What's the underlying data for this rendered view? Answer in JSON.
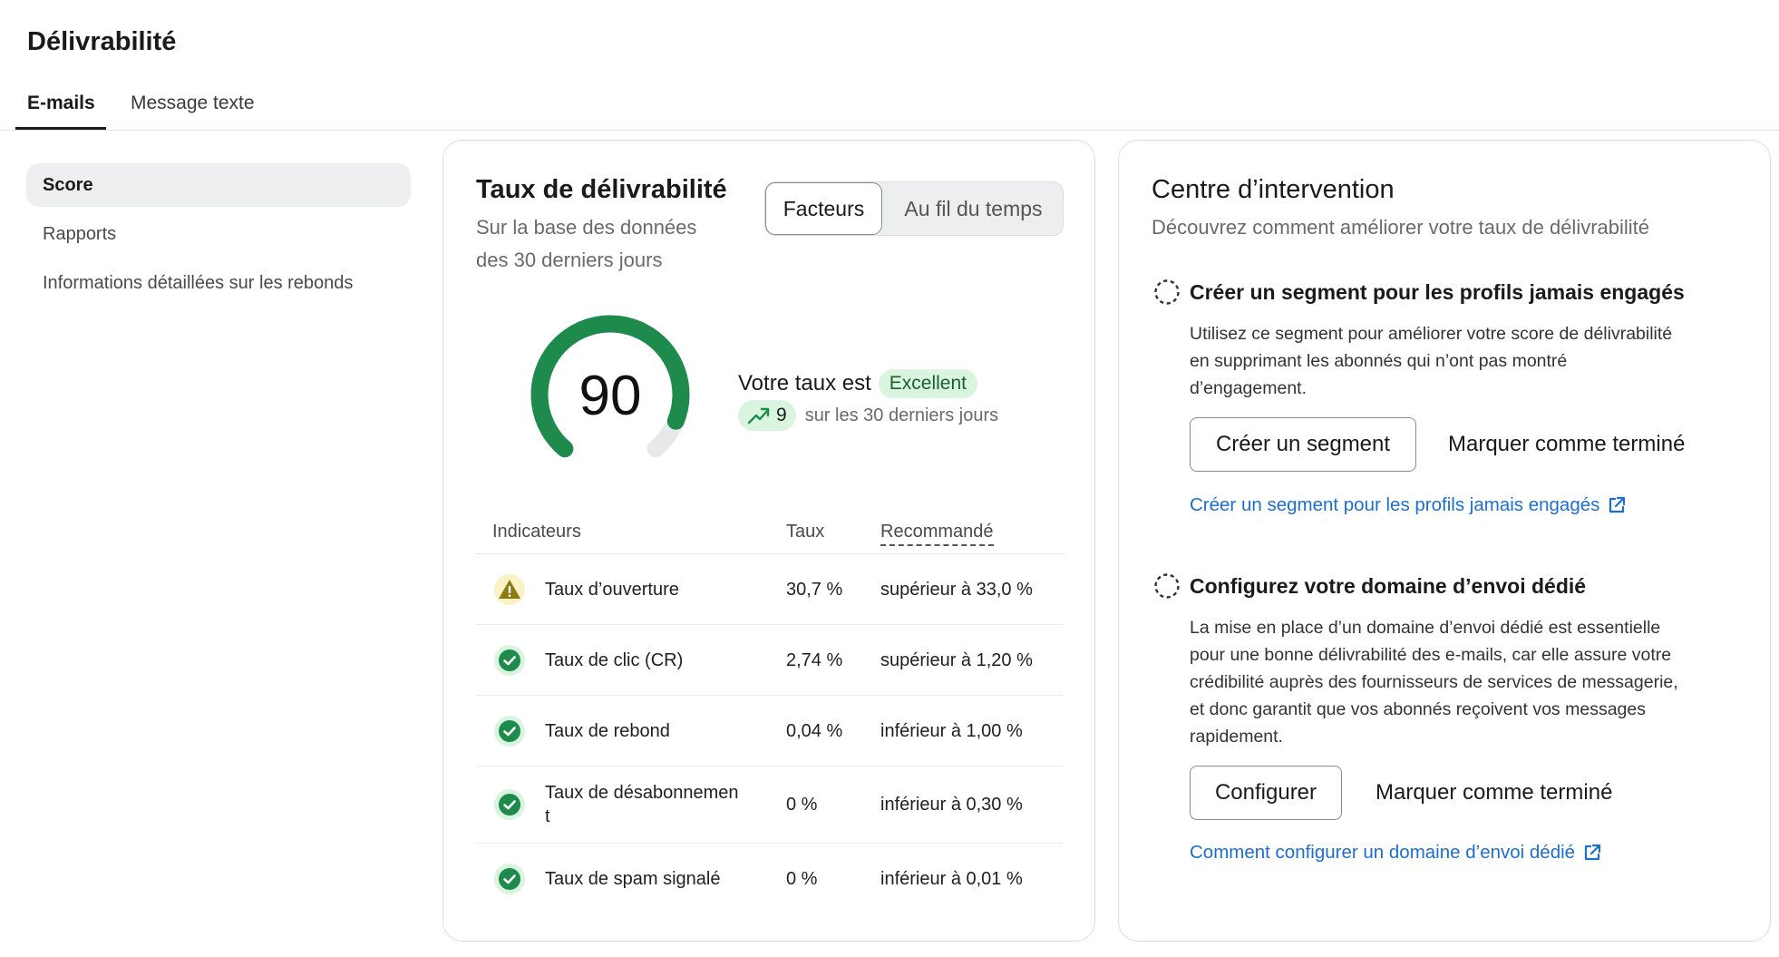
{
  "page": {
    "title": "Délivrabilité"
  },
  "tabs": [
    {
      "label": "E-mails",
      "active": true
    },
    {
      "label": "Message texte",
      "active": false
    }
  ],
  "sidebar": {
    "items": [
      {
        "label": "Score",
        "active": true
      },
      {
        "label": "Rapports",
        "active": false
      },
      {
        "label": "Informations détaillées sur les rebonds",
        "active": false
      }
    ]
  },
  "deliverability": {
    "title": "Taux de délivrabilité",
    "subtitle_line1": "Sur la base des données",
    "subtitle_line2": "des 30 derniers jours",
    "toggle": {
      "active": "Facteurs",
      "inactive": "Au fil du temps"
    },
    "score": {
      "value": "90",
      "max": 100,
      "fill_fraction": 0.9,
      "color": "#1e8a4c",
      "track_color": "#e6e8ea"
    },
    "rate_label": "Votre taux est",
    "rate_badge": "Excellent",
    "trend_value": "9",
    "trend_label": "sur les 30 derniers jours",
    "table": {
      "headers": {
        "indicator": "Indicateurs",
        "rate": "Taux",
        "recommended": "Recommandé"
      },
      "rows": [
        {
          "status": "warning",
          "indicator": "Taux d’ouverture",
          "rate": "30,7 %",
          "recommended": "supérieur à 33,0 %"
        },
        {
          "status": "ok",
          "indicator": "Taux de clic (CR)",
          "rate": "2,74 %",
          "recommended": "supérieur à 1,20 %"
        },
        {
          "status": "ok",
          "indicator": "Taux de rebond",
          "rate": "0,04 %",
          "recommended": "inférieur à 1,00 %"
        },
        {
          "status": "ok",
          "indicator_line1": "Taux de désabonnemen",
          "indicator_line2": "t",
          "rate": "0 %",
          "recommended": "inférieur à 0,30 %"
        },
        {
          "status": "ok",
          "indicator": "Taux de spam signalé",
          "rate": "0 %",
          "recommended": "inférieur à 0,01 %"
        }
      ]
    }
  },
  "action_center": {
    "title": "Centre d’intervention",
    "subtitle": "Découvrez comment améliorer votre taux de délivrabilité",
    "sections": [
      {
        "title": "Créer un segment pour les profils jamais engagés",
        "text_lines": [
          "Utilisez ce segment pour améliorer votre score de délivrabilité",
          "en supprimant les abonnés qui n’ont pas montré",
          "d’engagement."
        ],
        "primary_button": "Créer un segment",
        "secondary_button": "Marquer comme terminé",
        "link": "Créer un segment pour les profils jamais engagés"
      },
      {
        "title": "Configurez votre domaine d’envoi dédié",
        "text_lines": [
          "La mise en place d’un domaine d’envoi dédié est essentielle",
          "pour une bonne délivrabilité des e-mails, car elle assure votre",
          "crédibilité auprès des fournisseurs de services de messagerie,",
          "et donc garantit que vos abonnés reçoivent vos messages",
          "rapidement."
        ],
        "primary_button": "Configurer",
        "secondary_button": "Marquer comme terminé",
        "link": "Comment configurer un domaine d’envoi dédié"
      }
    ]
  },
  "colors": {
    "accent_green": "#1e8a4c",
    "badge_green_bg": "#d9f4df",
    "warning_yellow": "#f5e27a",
    "link_blue": "#1c6fd1"
  },
  "icons": {
    "warning": "warning-triangle-icon",
    "ok": "check-circle-icon",
    "trend": "trending-up-icon",
    "todo": "dashed-circle-icon",
    "external": "external-link-icon"
  }
}
